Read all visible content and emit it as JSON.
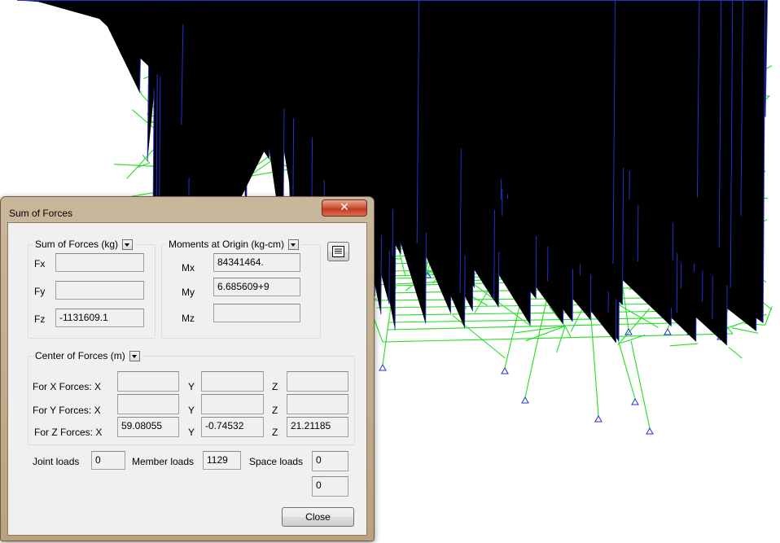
{
  "dialog": {
    "title": "Sum of Forces",
    "close_glyph": "✕",
    "sum_group": {
      "label": "Sum of Forces (kg)",
      "fx_label": "Fx",
      "fy_label": "Fy",
      "fz_label": "Fz",
      "fx": "",
      "fy": "",
      "fz": "-1131609.1"
    },
    "moment_group": {
      "label": "Moments at Origin (kg-cm)",
      "mx_label": "Mx",
      "my_label": "My",
      "mz_label": "Mz",
      "mx": "84341464.",
      "my": "6.685609+9",
      "mz": ""
    },
    "center_group": {
      "label": "Center of Forces (m)",
      "x_forces_label": "For X Forces:  X",
      "y_forces_label": "For Y Forces:  X",
      "z_forces_label": "For Z Forces:  X",
      "y_label": "Y",
      "z_label": "Z",
      "x_row": {
        "x": "",
        "y": "",
        "z": ""
      },
      "y_row": {
        "x": "",
        "y": "",
        "z": ""
      },
      "z_row": {
        "x": "59.08055",
        "y": "-0.74532",
        "z": "21.21185"
      }
    },
    "loads": {
      "joint_label": "Joint loads",
      "joint_value": "0",
      "member_label": "Member loads",
      "member_value": "1129",
      "space_label": "Space loads",
      "space_value_1": "0",
      "space_value_2": "0"
    },
    "close_button_label": "Close",
    "colors": {
      "frame_lines": "#22dd22",
      "joint_markers": "#2233cc",
      "titlebar": "#c2ab88",
      "close_red": "#c8462b"
    }
  }
}
